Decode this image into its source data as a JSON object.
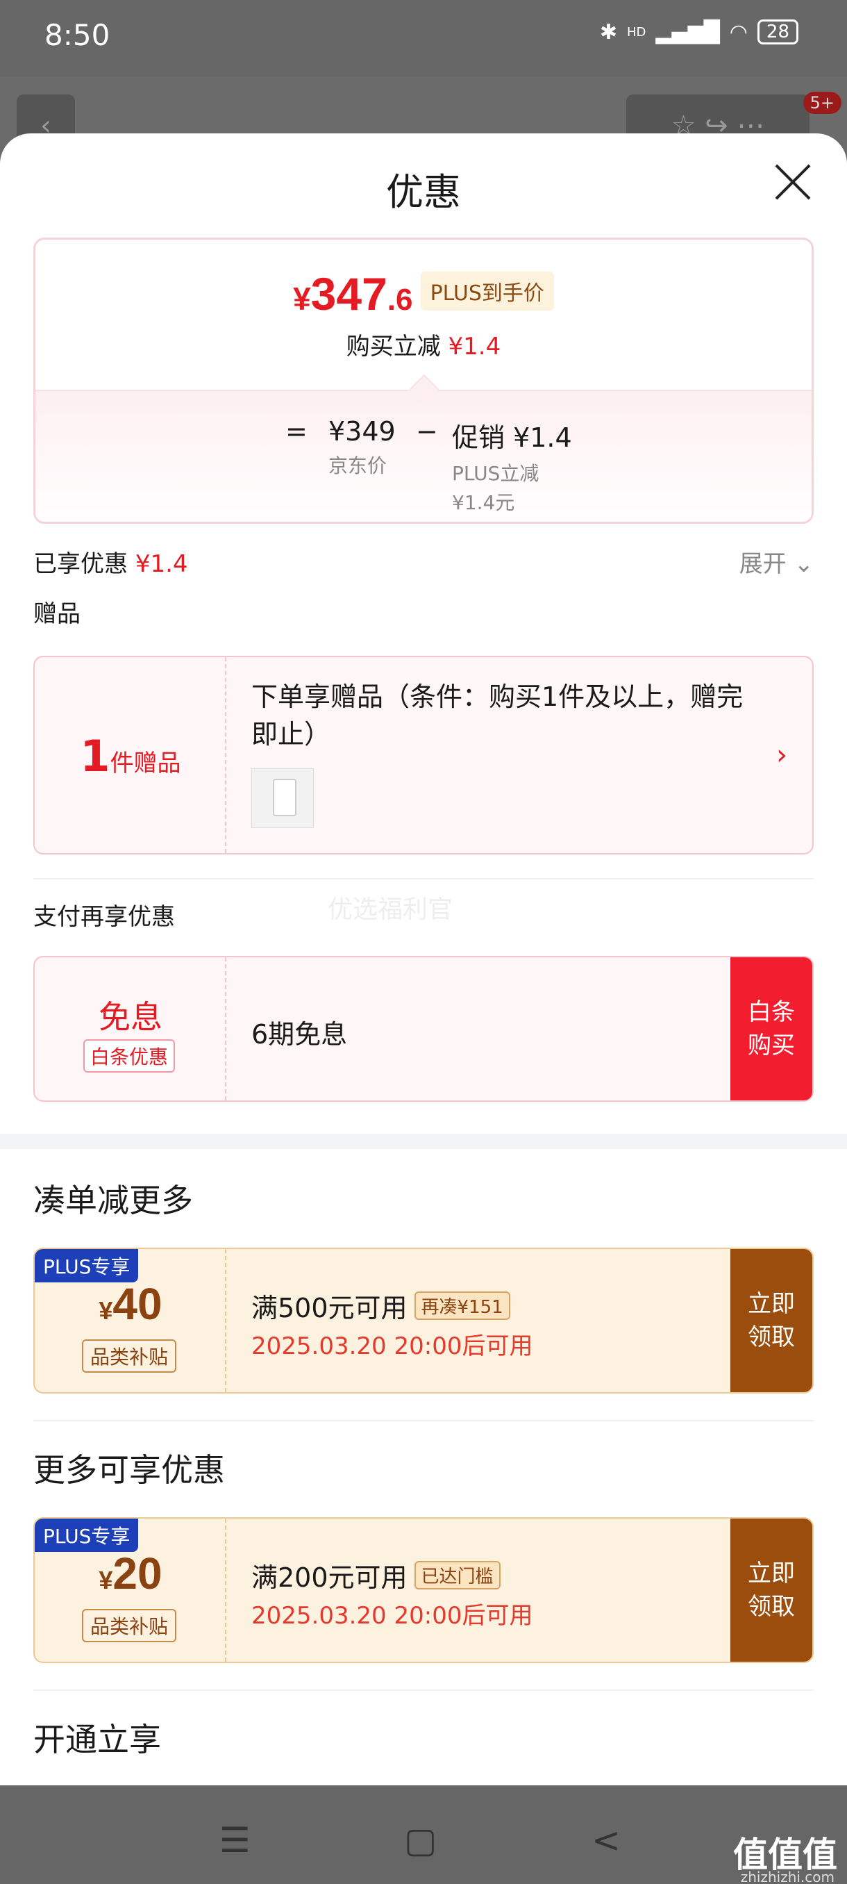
{
  "status_bar": {
    "time": "8:50",
    "hd": "HD",
    "battery": "28"
  },
  "background": {
    "badge": "5+"
  },
  "sheet": {
    "title": "优惠",
    "price": {
      "yen": "¥",
      "int": "347",
      "dec": ".6",
      "tag": "PLUS到手价",
      "reduce_label": "购买立减",
      "reduce_value": "¥1.4",
      "eq": "=",
      "jd_price": "¥349",
      "jd_price_label": "京东价",
      "minus": "−",
      "promo_label": "促销 ¥1.4",
      "promo_sub1": "PLUS立减",
      "promo_sub2": "¥1.4元"
    },
    "enjoyed": {
      "label": "已享优惠",
      "value": "¥1.4",
      "expand": "展开"
    },
    "gift": {
      "section": "赠品",
      "count": "1",
      "count_unit": "件赠品",
      "text": "下单享赠品（条件：购买1件及以上，赠完即止）"
    },
    "watermark": "优选福利官",
    "pay": {
      "section": "支付再享优惠",
      "title": "免息",
      "tag": "白条优惠",
      "text": "6期免息",
      "button": "白条购买"
    },
    "bundle": {
      "section": "凑单减更多",
      "coupon": {
        "badge": "PLUS专享",
        "yen": "¥",
        "amount": "40",
        "category": "品类补贴",
        "condition": "满500元可用",
        "cond_tag": "再凑¥151",
        "date": "2025.03.20 20:00后可用",
        "button": "立即领取"
      }
    },
    "more": {
      "section": "更多可享优惠",
      "coupon": {
        "badge": "PLUS专享",
        "yen": "¥",
        "amount": "20",
        "category": "品类补贴",
        "condition": "满200元可用",
        "cond_tag": "已达门槛",
        "date": "2025.03.20 20:00后可用",
        "button": "立即领取"
      }
    },
    "open": {
      "section": "开通立享"
    }
  },
  "nav": {
    "menu": "☰",
    "home": "▢",
    "back": "<"
  },
  "watermark_brand": {
    "name": "值值值",
    "url": "zhizhizhi.com"
  }
}
